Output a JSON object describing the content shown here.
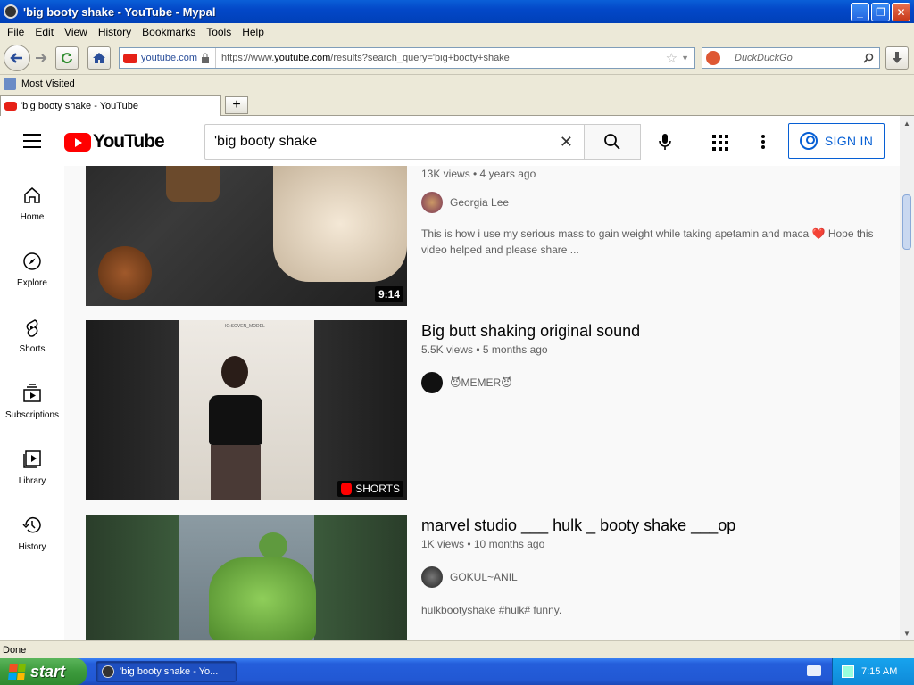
{
  "window": {
    "title": "'big booty shake - YouTube - Mypal"
  },
  "menu": [
    "File",
    "Edit",
    "View",
    "History",
    "Bookmarks",
    "Tools",
    "Help"
  ],
  "nav": {
    "site_label": "youtube.com",
    "url_prefix": "https://www.",
    "url_domain": "youtube.com",
    "url_path": "/results?search_query='big+booty+shake",
    "search_placeholder": "DuckDuckGo"
  },
  "bookmarks": {
    "most_visited": "Most Visited"
  },
  "tab": {
    "label": "'big booty shake - YouTube"
  },
  "youtube": {
    "logo_text": "YouTube",
    "search_value": "'big booty shake",
    "signin_label": "SIGN IN"
  },
  "sidebar": [
    {
      "label": "Home",
      "icon": "home-icon"
    },
    {
      "label": "Explore",
      "icon": "compass-icon"
    },
    {
      "label": "Shorts",
      "icon": "shorts-icon"
    },
    {
      "label": "Subscriptions",
      "icon": "subscriptions-icon"
    },
    {
      "label": "Library",
      "icon": "library-icon"
    },
    {
      "label": "History",
      "icon": "history-icon"
    }
  ],
  "results": [
    {
      "title": "",
      "meta": "13K views • 4 years ago",
      "channel": "Georgia Lee",
      "description": "This is how i use my serious mass to gain weight while taking apetamin and maca ❤️ Hope this video helped and please share ...",
      "duration": "9:14"
    },
    {
      "title": "Big butt shaking original sound",
      "meta": "5.5K views • 5 months ago",
      "channel": "😈MEMER😈",
      "description": "",
      "badge": "SHORTS",
      "thumb_caption": "IG:SOVEN_MODEL"
    },
    {
      "title": "marvel studio ___ hulk _ booty shake ___op",
      "meta": "1K views • 10 months ago",
      "channel": "GOKUL~ANIL",
      "description": "hulkbootyshake #hulk# funny."
    }
  ],
  "status": {
    "text": "Done"
  },
  "taskbar": {
    "start": "start",
    "task": "'big booty shake - Yo...",
    "clock": "7:15 AM"
  },
  "colors": {
    "yt_red": "#ff0000",
    "link_blue": "#065fd4",
    "xp_blue": "#245edb"
  }
}
